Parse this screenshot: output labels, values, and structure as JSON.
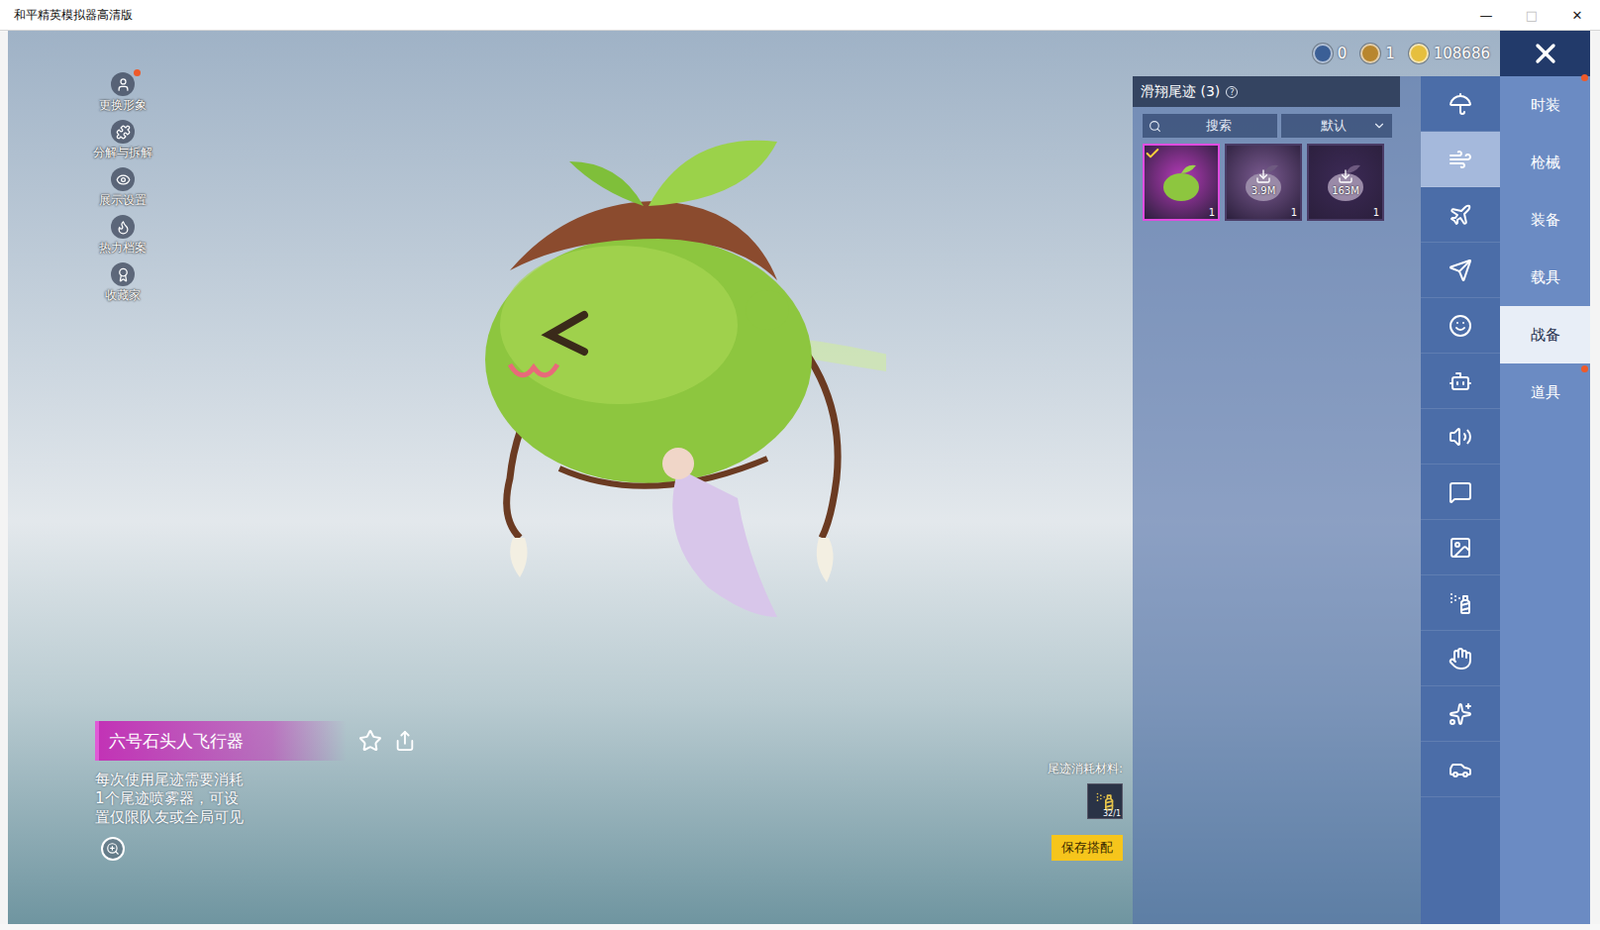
{
  "window": {
    "title": "和平精英模拟器高清版",
    "controls": [
      "—",
      "□",
      "✕"
    ]
  },
  "side_menu": [
    {
      "label": "更换形象",
      "badge": true
    },
    {
      "label": "分解与拆解",
      "badge": false
    },
    {
      "label": "展示设置",
      "badge": false
    },
    {
      "label": "热力档案",
      "badge": false
    },
    {
      "label": "收藏家",
      "badge": false
    }
  ],
  "currencies": [
    {
      "amount": "0",
      "color": "#3b5f96"
    },
    {
      "amount": "1",
      "color": "#b8862e"
    },
    {
      "amount": "108686",
      "color": "#e6bf3e"
    }
  ],
  "close": {
    "badge": true
  },
  "panel": {
    "title": "滑翔尾迹 (3)",
    "help": "?",
    "search": {
      "placeholder": "搜索"
    },
    "sort": {
      "value": "默认"
    },
    "items": [
      {
        "kind": "owned",
        "count": "1",
        "selected": true,
        "color": "#b53ab8"
      },
      {
        "kind": "download",
        "size": "3.9M",
        "count": "1",
        "selected": false,
        "color": "#7c5c92"
      },
      {
        "kind": "download",
        "size": "163M",
        "count": "1",
        "selected": false,
        "color": "#3c2a56"
      }
    ]
  },
  "icon_tabs": [
    {
      "selected": false
    },
    {
      "selected": true
    },
    {
      "selected": false
    },
    {
      "selected": false
    },
    {
      "selected": false
    },
    {
      "selected": false
    },
    {
      "selected": false
    },
    {
      "selected": false
    },
    {
      "selected": false
    },
    {
      "selected": false
    },
    {
      "selected": false
    },
    {
      "selected": false
    },
    {
      "selected": false
    }
  ],
  "categories": [
    {
      "label": "时装",
      "selected": false,
      "badge": false
    },
    {
      "label": "枪械",
      "selected": false,
      "badge": false
    },
    {
      "label": "装备",
      "selected": false,
      "badge": false
    },
    {
      "label": "载具",
      "selected": false,
      "badge": false
    },
    {
      "label": "战备",
      "selected": true,
      "badge": false
    },
    {
      "label": "道具",
      "selected": false,
      "badge": true
    }
  ],
  "item": {
    "name": "六号石头人飞行器",
    "favorite": false,
    "description": "每次使用尾迹需要消耗1个尾迹喷雾器，可设置仅限队友或全局可见"
  },
  "material": {
    "label": "尾迹消耗材料:",
    "count": "32/1"
  },
  "save_button": "保存搭配"
}
